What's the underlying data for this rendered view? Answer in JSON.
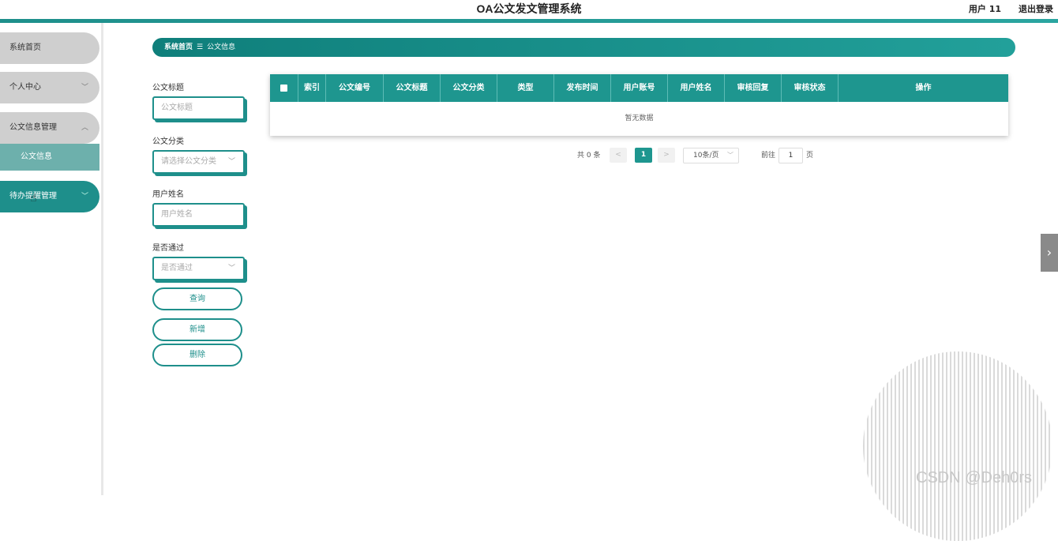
{
  "header": {
    "title": "OA公文发文管理系统",
    "user": "用户 11",
    "logout": "退出登录"
  },
  "sidebar": {
    "items": [
      {
        "label": "系统首页"
      },
      {
        "label": "个人中心"
      },
      {
        "label": "公文信息管理"
      },
      {
        "label": "公文信息"
      },
      {
        "label": "待办提醒管理"
      }
    ]
  },
  "breadcrumb": {
    "home": "系统首页",
    "separator": "☰",
    "current": "公文信息"
  },
  "filters": {
    "title_label": "公文标题",
    "title_placeholder": "公文标题",
    "category_label": "公文分类",
    "category_placeholder": "请选择公文分类",
    "username_label": "用户姓名",
    "username_placeholder": "用户姓名",
    "passed_label": "是否通过",
    "passed_placeholder": "是否通过",
    "query_button": "查询",
    "add_button": "新增",
    "delete_button": "删除"
  },
  "table": {
    "columns": [
      "索引",
      "公文编号",
      "公文标题",
      "公文分类",
      "类型",
      "发布时间",
      "用户账号",
      "用户姓名",
      "审核回复",
      "审核状态",
      "操作"
    ],
    "empty_text": "暂无数据"
  },
  "pagination": {
    "total": "共 0 条",
    "prev": "<",
    "current_page": "1",
    "next": ">",
    "page_size": "10条/页",
    "goto_label": "前往",
    "goto_value": "1",
    "page_suffix": "页"
  },
  "watermark": "CSDN @Deh0rs",
  "colors": {
    "accent": "#1e968f",
    "sidebar_inactive": "#cfcfcf"
  }
}
